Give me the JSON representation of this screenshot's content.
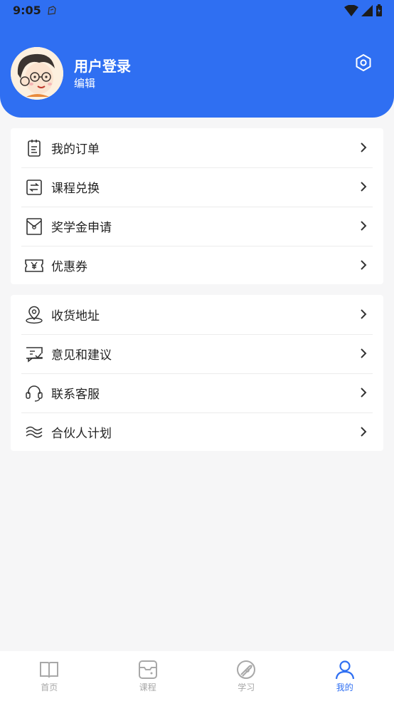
{
  "status_bar": {
    "time": "9:05"
  },
  "header": {
    "title": "用户登录",
    "subtitle": "编辑",
    "bg_color": "#2f6ff2"
  },
  "menu_group_1": [
    {
      "label": "我的订单",
      "icon": "order-list-icon"
    },
    {
      "label": "课程兑换",
      "icon": "exchange-icon"
    },
    {
      "label": "奖学金申请",
      "icon": "envelope-icon"
    },
    {
      "label": "优惠券",
      "icon": "coupon-icon"
    }
  ],
  "menu_group_2": [
    {
      "label": "收货地址",
      "icon": "location-icon"
    },
    {
      "label": "意见和建议",
      "icon": "feedback-icon"
    },
    {
      "label": "联系客服",
      "icon": "headset-icon"
    },
    {
      "label": "合伙人计划",
      "icon": "partner-icon"
    }
  ],
  "tabbar": {
    "items": [
      {
        "label": "首页",
        "icon": "book-icon"
      },
      {
        "label": "课程",
        "icon": "course-icon"
      },
      {
        "label": "学习",
        "icon": "learn-icon"
      },
      {
        "label": "我的",
        "icon": "user-icon",
        "active": true
      }
    ],
    "active_color": "#2f6ff2"
  }
}
